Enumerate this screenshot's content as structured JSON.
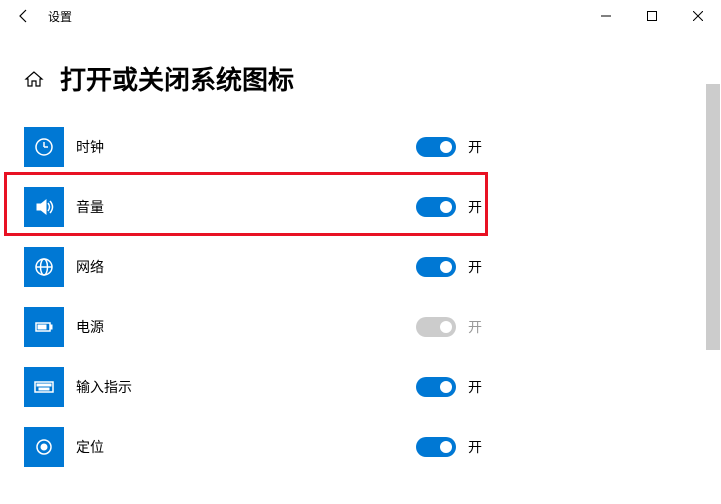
{
  "window": {
    "title": "设置"
  },
  "page": {
    "title": "打开或关闭系统图标"
  },
  "settings": [
    {
      "label": "时钟",
      "state": "开",
      "on": true,
      "icon": "clock"
    },
    {
      "label": "音量",
      "state": "开",
      "on": true,
      "icon": "volume"
    },
    {
      "label": "网络",
      "state": "开",
      "on": true,
      "icon": "network"
    },
    {
      "label": "电源",
      "state": "开",
      "on": false,
      "icon": "power"
    },
    {
      "label": "输入指示",
      "state": "开",
      "on": true,
      "icon": "keyboard"
    },
    {
      "label": "定位",
      "state": "开",
      "on": true,
      "icon": "location"
    }
  ]
}
